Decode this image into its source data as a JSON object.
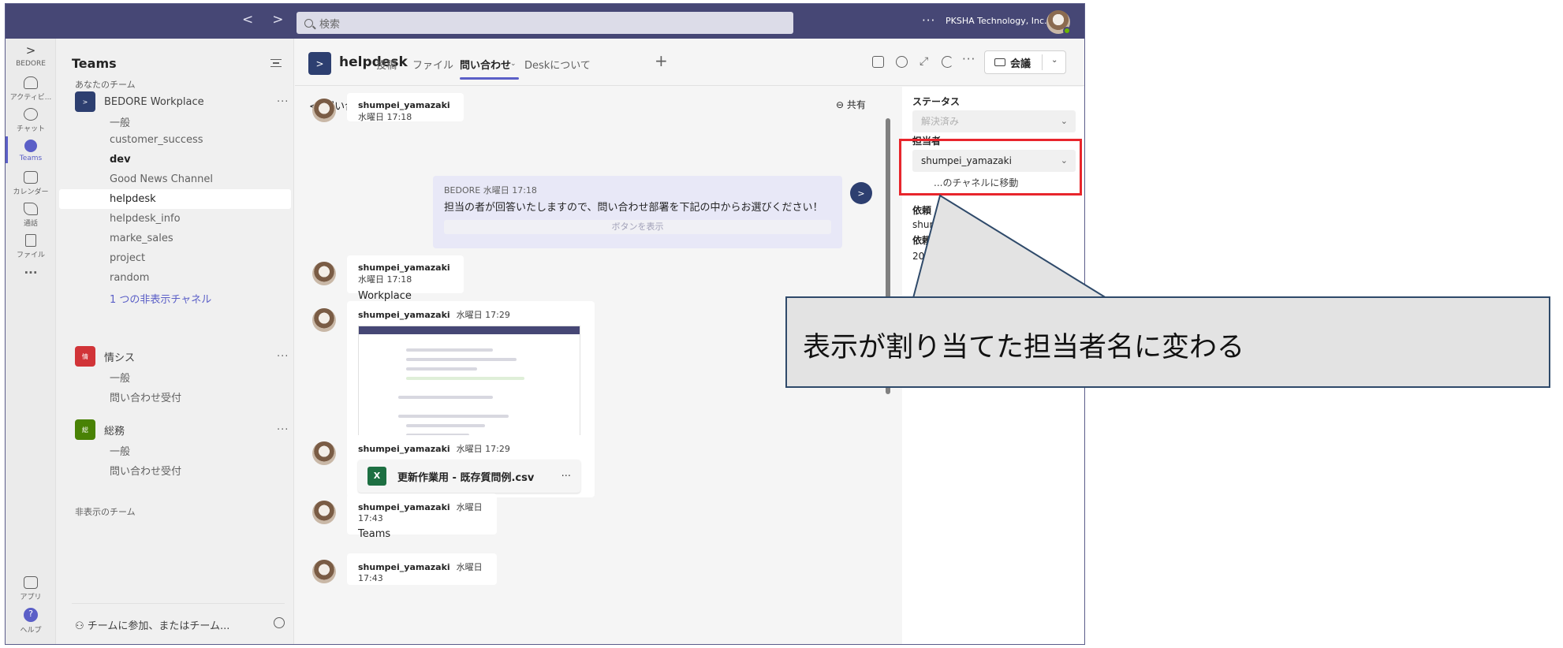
{
  "topbar": {
    "search_placeholder": "検索",
    "org": "PKSHA Technology, Inc.",
    "more": "···",
    "back": "<",
    "fwd": ">"
  },
  "rail": [
    {
      "label": "BEDORE",
      "icon": "bedore-icon"
    },
    {
      "label": "アクティビ...",
      "icon": "bell-icon"
    },
    {
      "label": "チャット",
      "icon": "chat-icon"
    },
    {
      "label": "Teams",
      "icon": "teams-icon"
    },
    {
      "label": "カレンダー",
      "icon": "calendar-icon"
    },
    {
      "label": "通話",
      "icon": "phone-icon"
    },
    {
      "label": "ファイル",
      "icon": "file-icon"
    },
    {
      "label": "···",
      "icon": "more-icon"
    },
    {
      "label": "アプリ",
      "icon": "apps-icon"
    },
    {
      "label": "ヘルプ",
      "icon": "help-icon"
    }
  ],
  "teams": {
    "title": "Teams",
    "your_teams": "あなたのチーム",
    "hidden_teams": "非表示のチーム",
    "join": "チームに参加、またはチーム...",
    "list": [
      {
        "name": "BEDORE Workplace",
        "color": "#2d3f70",
        "abbr": ">",
        "channels": [
          "一般",
          "customer_success",
          "dev",
          "Good News Channel",
          "helpdesk",
          "helpdesk_info",
          "marke_sales",
          "project",
          "random",
          "1 つの非表示チャネル"
        ]
      },
      {
        "name": "情シス",
        "color": "#d13438",
        "abbr": "情",
        "channels": [
          "一般",
          "問い合わせ受付"
        ]
      },
      {
        "name": "総務",
        "color": "#498205",
        "abbr": "総",
        "channels": [
          "一般",
          "問い合わせ受付"
        ]
      }
    ]
  },
  "header": {
    "channel": "helpdesk",
    "tabs": [
      "投稿",
      "ファイル",
      "問い合わせ",
      "Deskについて"
    ],
    "plus": "+",
    "meet": "会議",
    "more": "···"
  },
  "conversation": {
    "back": "問い合わせ一覧",
    "share": "共有",
    "messages": [
      {
        "user": "shumpei_yamazaki",
        "time": "水曜日 17:18",
        "text": ""
      },
      {
        "user": "BEDORE",
        "time": "水曜日 17:18",
        "text": "担当の者が回答いたしますので、問い合わせ部署を下記の中からお選びください！",
        "button": "ボタンを表示"
      },
      {
        "user": "shumpei_yamazaki",
        "time": "水曜日 17:18",
        "text": "Workplace"
      },
      {
        "user": "shumpei_yamazaki",
        "time": "水曜日 17:29",
        "text": ""
      },
      {
        "user": "shumpei_yamazaki",
        "time": "水曜日 17:29",
        "file": "更新作業用 - 既存質問例.csv",
        "file_more": "···"
      },
      {
        "user": "shumpei_yamazaki",
        "time": "水曜日 17:43",
        "text": "Teams"
      },
      {
        "user": "shumpei_yamazaki",
        "time": "水曜日 17:43",
        "text": ""
      }
    ]
  },
  "panel": {
    "status_label": "ステータス",
    "status_value": "解決済み",
    "assignee_label": "担当者",
    "assignee_value": "shumpei_yamazaki",
    "move_link": "...のチャネルに移動",
    "requester_label": "依頼",
    "requester_value": "shum",
    "date_label": "依頼",
    "date_value": "20"
  },
  "callout": {
    "text": "表示が割り当てた担当者名に変わる"
  },
  "colors": {
    "brand": "#464775",
    "accent": "#5b5fc7",
    "highlight": "#e8252c",
    "callout_border": "#2f4a6a"
  }
}
